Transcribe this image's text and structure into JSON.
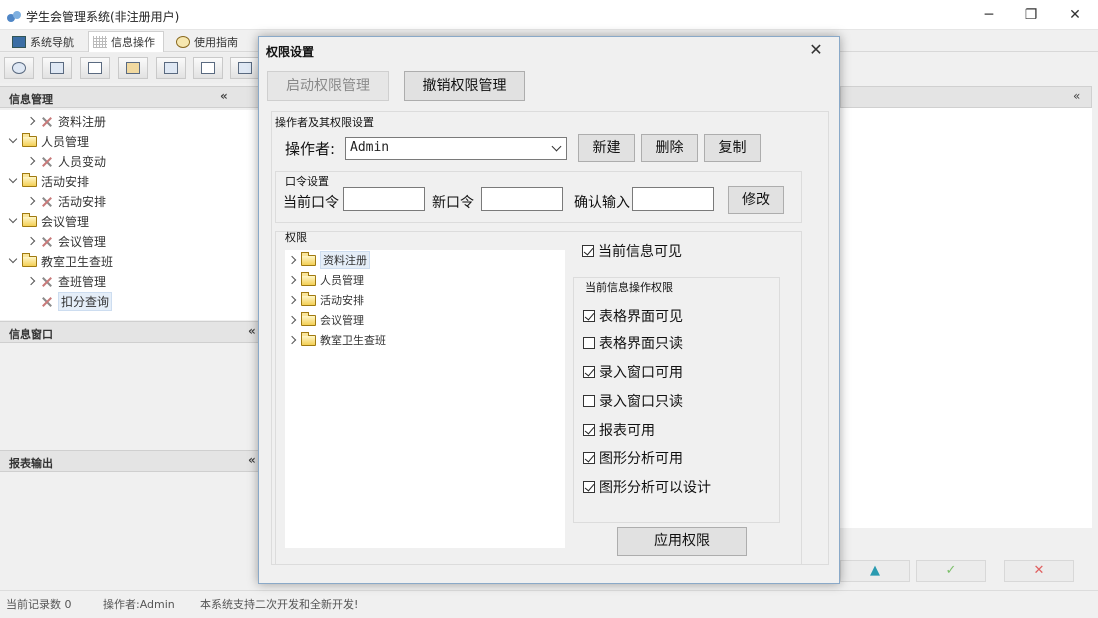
{
  "app": {
    "title": "学生会管理系统(非注册用户)",
    "minimize": "─",
    "maximize": "❐",
    "close": "✕"
  },
  "tabs": [
    {
      "label": "系统导航"
    },
    {
      "label": "信息操作"
    },
    {
      "label": "使用指南"
    }
  ],
  "left": {
    "panel1": {
      "title": "信息管理"
    },
    "panel2": {
      "title": "信息窗口"
    },
    "panel3": {
      "title": "报表输出"
    },
    "tree": [
      {
        "label": "资料注册"
      },
      {
        "label": "人员管理"
      },
      {
        "label": "人员变动"
      },
      {
        "label": "活动安排"
      },
      {
        "label": "活动安排"
      },
      {
        "label": "会议管理"
      },
      {
        "label": "会议管理"
      },
      {
        "label": "教室卫生查班"
      },
      {
        "label": "查班管理"
      },
      {
        "label": "扣分查询"
      }
    ]
  },
  "status": {
    "record_count": "当前记录数 0",
    "operator": "操作者:Admin",
    "message": "本系统支持二次开发和全新开发!"
  },
  "right_nav": {
    "up": "▲",
    "confirm": "✓",
    "cancel": "✕"
  },
  "dialog": {
    "title": "权限设置",
    "close": "✕",
    "enable_btn": "启动权限管理",
    "revoke_btn": "撤销权限管理",
    "operator_group": "操作者及其权限设置",
    "operator_label": "操作者:",
    "operator_value": "Admin",
    "new_btn": "新建",
    "delete_btn": "删除",
    "copy_btn": "复制",
    "password_group": "口令设置",
    "current_pwd": "当前口令",
    "new_pwd": "新口令",
    "confirm_pwd": "确认输入",
    "modify_btn": "修改",
    "perm_group": "权限",
    "perm_tree": [
      {
        "label": "资料注册"
      },
      {
        "label": "人员管理"
      },
      {
        "label": "活动安排"
      },
      {
        "label": "会议管理"
      },
      {
        "label": "教室卫生查班"
      }
    ],
    "visible_check": {
      "label": "当前信息可见",
      "checked": true
    },
    "ops_group": "当前信息操作权限",
    "ops": [
      {
        "label": "表格界面可见",
        "checked": true
      },
      {
        "label": "表格界面只读",
        "checked": false
      },
      {
        "label": "录入窗口可用",
        "checked": true
      },
      {
        "label": "录入窗口只读",
        "checked": false
      },
      {
        "label": "报表可用",
        "checked": true
      },
      {
        "label": "图形分析可用",
        "checked": true
      },
      {
        "label": "图形分析可以设计",
        "checked": true
      }
    ],
    "apply_btn": "应用权限"
  }
}
